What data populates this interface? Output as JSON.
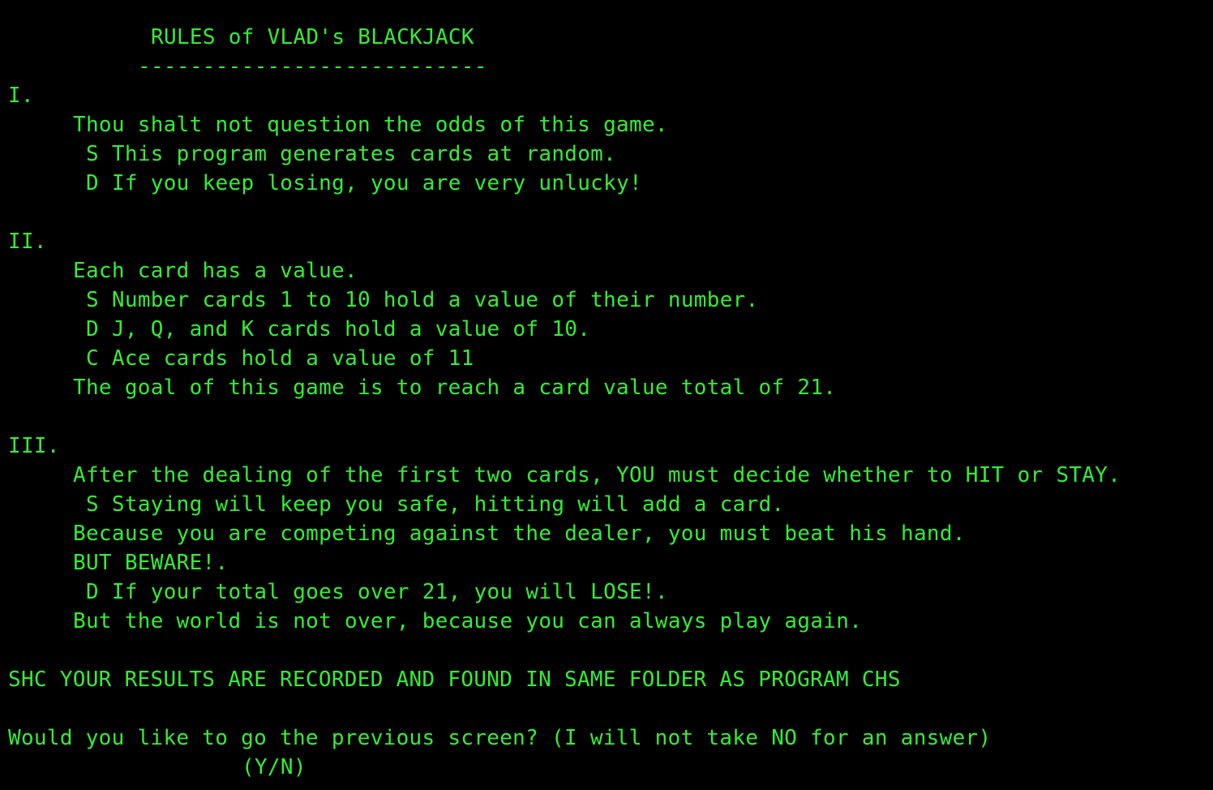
{
  "terminal": {
    "title": "RULES of VLAD's BLACKJACK",
    "title_rule": "---------------------------",
    "section1": {
      "numeral": "I.",
      "rule": "Thou shalt not question the odds of this game.",
      "note_s": "S This program generates cards at random.",
      "note_d": "D If you keep losing, you are very unlucky!"
    },
    "section2": {
      "numeral": "II.",
      "rule": "Each card has a value.",
      "note_s": "S Number cards 1 to 10 hold a value of their number.",
      "note_d": "D J, Q, and K cards hold a value of 10.",
      "note_c": "C Ace cards hold a value of 11",
      "goal": "The goal of this game is to reach a card value total of 21."
    },
    "section3": {
      "numeral": "III.",
      "rule": "After the dealing of the first two cards, YOU must decide whether to HIT or STAY.",
      "note_s": "S Staying will keep you safe, hitting will add a card.",
      "compete": "Because you are competing against the dealer, you must beat his hand.",
      "beware": "BUT BEWARE!.",
      "note_d": "D If your total goes over 21, you will LOSE!.",
      "again": "But the world is not over, because you can always play again."
    },
    "results_notice": "SHC YOUR RESULTS ARE RECORDED AND FOUND IN SAME FOLDER AS PROGRAM CHS",
    "prompt": "Would you like to go the previous screen? (I will not take NO for an answer)",
    "prompt_options": "(Y/N)",
    "colors": {
      "background": "#000000",
      "text": "#33ee33"
    }
  }
}
